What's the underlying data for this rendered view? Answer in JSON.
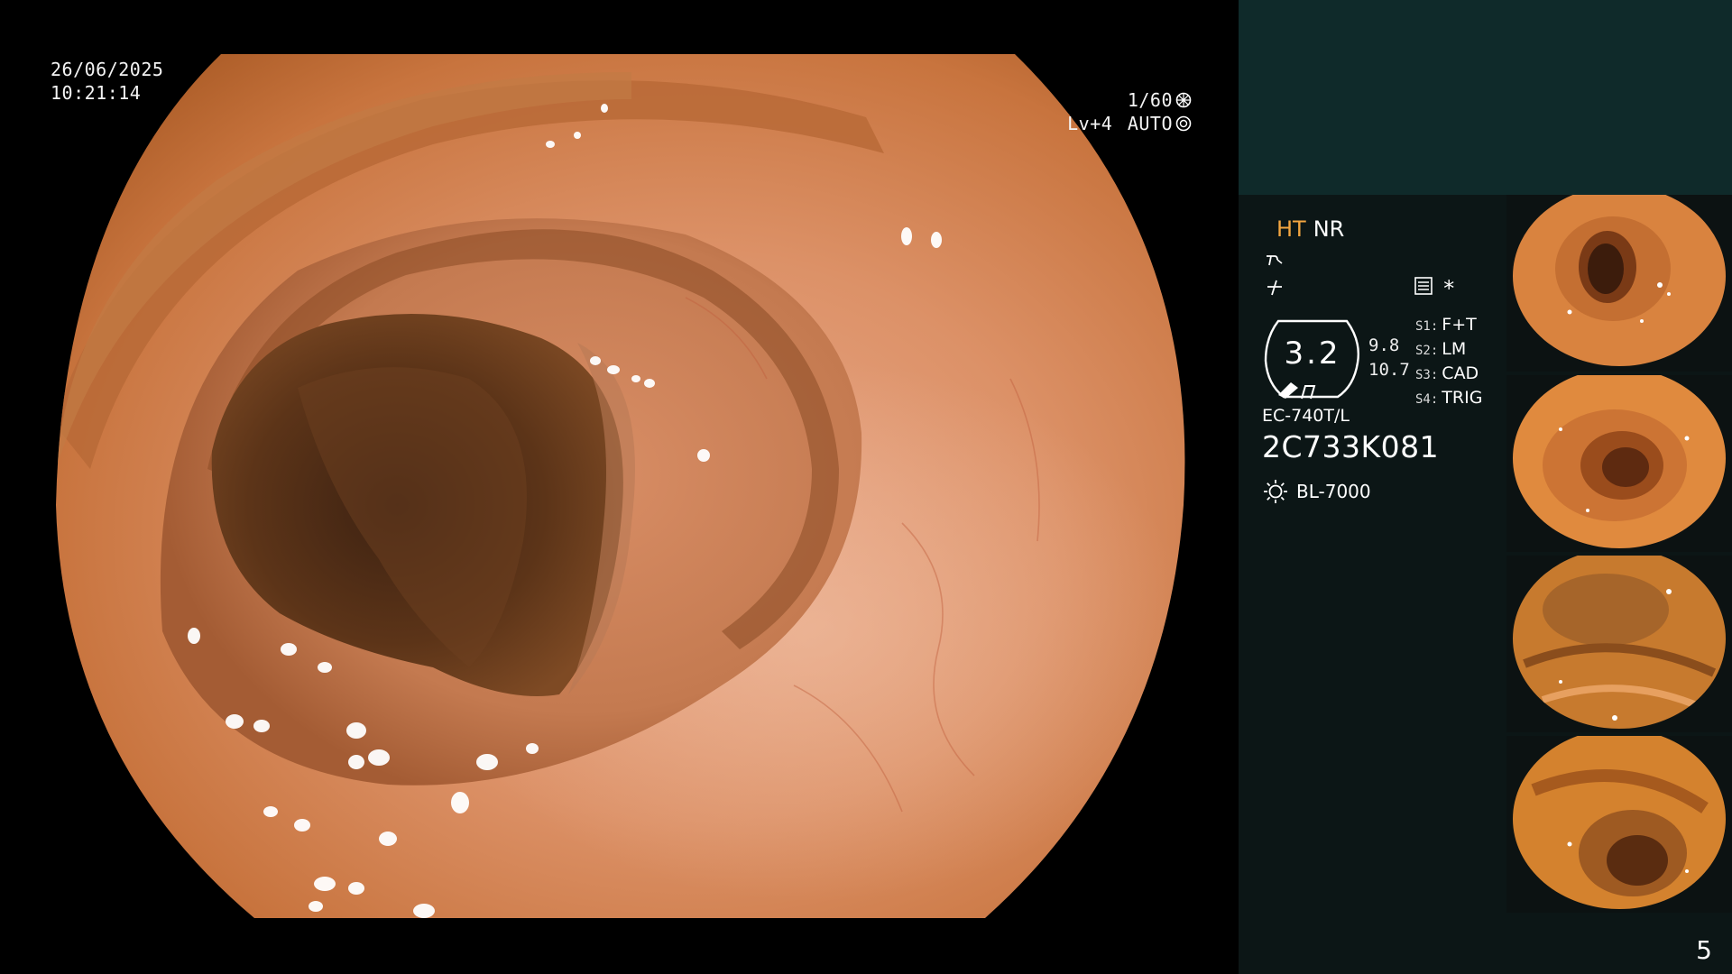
{
  "osd": {
    "date": "26/06/2025",
    "time": "10:21:14",
    "shutter": "1/60",
    "level": "Lv+4",
    "iris_mode": "AUTO"
  },
  "panel": {
    "mode_ht": "HT",
    "mode_nr": "NR",
    "asterisk": "*",
    "zoom": "3.2",
    "lens_value_1": "9.8",
    "lens_value_2": "10.7",
    "switches": [
      {
        "key": "S1:",
        "label": "F+T"
      },
      {
        "key": "S2:",
        "label": "LM"
      },
      {
        "key": "S3:",
        "label": "CAD"
      },
      {
        "key": "S4:",
        "label": "TRIG"
      }
    ],
    "scope_model": "EC-740T/L",
    "scope_serial": "2C733K081",
    "light_source": "BL-7000",
    "page_number": "5",
    "colors": {
      "panel_bg": "#0c1616",
      "panel_top": "#0f2a2a",
      "ht_accent": "#f3a640"
    }
  },
  "thumbnails": [
    {
      "name": "capture-1"
    },
    {
      "name": "capture-2"
    },
    {
      "name": "capture-3"
    },
    {
      "name": "capture-4"
    }
  ]
}
